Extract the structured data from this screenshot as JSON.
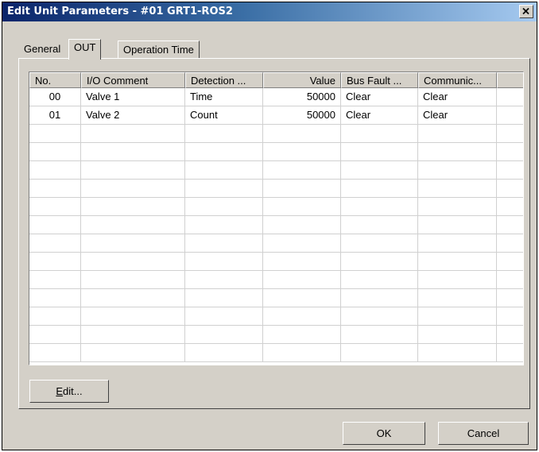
{
  "window": {
    "title": "Edit Unit Parameters - #01 GRT1-ROS2",
    "close_glyph": "×"
  },
  "tabs": [
    {
      "label": "General",
      "active": false
    },
    {
      "label": "OUT",
      "active": true
    },
    {
      "label": "Operation Time",
      "active": false
    }
  ],
  "table": {
    "columns": [
      "No.",
      "I/O Comment",
      "Detection ...",
      "Value",
      "Bus Fault ...",
      "Communic..."
    ],
    "rows": [
      {
        "no": "00",
        "comment": "Valve 1",
        "detection": "Time",
        "value": "50000",
        "bus_fault": "Clear",
        "communication": "Clear"
      },
      {
        "no": "01",
        "comment": "Valve 2",
        "detection": "Count",
        "value": "50000",
        "bus_fault": "Clear",
        "communication": "Clear"
      }
    ]
  },
  "buttons": {
    "edit_mnemonic": "E",
    "edit_rest": "dit...",
    "ok": "OK",
    "cancel": "Cancel"
  }
}
